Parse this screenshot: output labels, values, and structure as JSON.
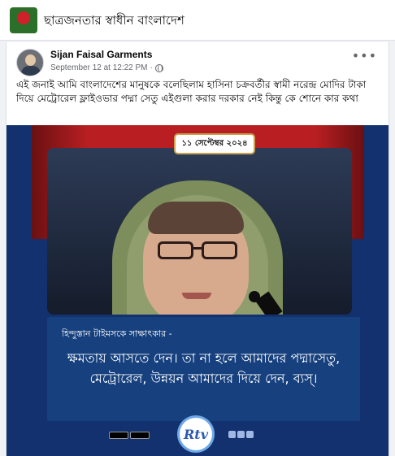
{
  "group": {
    "name": "ছাত্রজনতার স্বাধীন বাংলাদেশ",
    "avatar_icon": "group-logo-icon"
  },
  "post": {
    "author": "Sijan Faisal Garments",
    "timestamp": "September 12 at 12:22 PM",
    "separator": "·",
    "audience_icon": "globe-icon",
    "more_icon": "more-options-icon",
    "more_glyph": "•••",
    "text": "এই জনাই আমি বাংলাদেশের মানুষকে বলেছিলাম হাসিনা চক্রবর্তীর স্বামী নরেন্দ্র মোদির টাকা দিয়ে মেট্রোরেল ফ্লাইওভার পদ্মা সেতু এইগুলা করার দরকার নেই কিন্তু কে শোনে কার কথা"
  },
  "media": {
    "date": "১১ সেপ্টেম্বর ২০২৪",
    "caption_small": "হিন্দুস্তান টাইমসকে সাক্ষাৎকার -",
    "caption_big": "ক্ষমতায় আসতে দেন। তা না হলে আমাদের পদ্মাসেতু, মেট্রোরেল, উন্নয়ন আমাদের দিয়ে দেন, ব্যস্।",
    "logo": "Rtv",
    "colors": {
      "background": "#13316e",
      "red_banner": "#b91f22",
      "caption_box": "#16407e"
    }
  }
}
